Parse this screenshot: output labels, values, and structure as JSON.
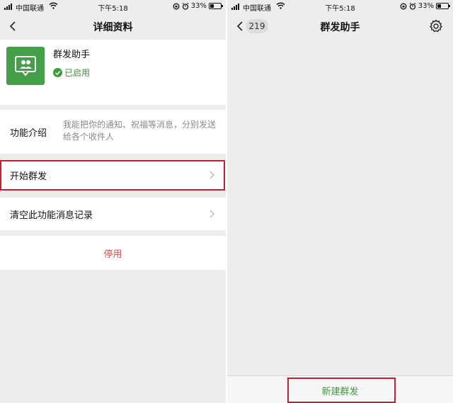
{
  "status_bar": {
    "carrier": "中国联通",
    "time": "下午5:18",
    "battery": "33%",
    "battery_level": 0.33
  },
  "left_screen": {
    "nav_title": "详细资料",
    "profile": {
      "name": "群发助手",
      "status": "已启用",
      "icon": "group-chat-icon"
    },
    "function_intro": {
      "label": "功能介绍",
      "description": "我能把你的通知、祝福等消息，分别发送给各个收件人"
    },
    "start_mass": "开始群发",
    "clear_records": "清空此功能消息记录",
    "disable": "停用"
  },
  "right_screen": {
    "nav_title": "群发助手",
    "back_count": "219",
    "new_mass": "新建群发"
  },
  "colors": {
    "accent_green": "#43a049",
    "highlight_red": "#c8202a",
    "danger_text": "#d14f4f",
    "secondary_text": "#8a8a8a",
    "background": "#ededed"
  }
}
